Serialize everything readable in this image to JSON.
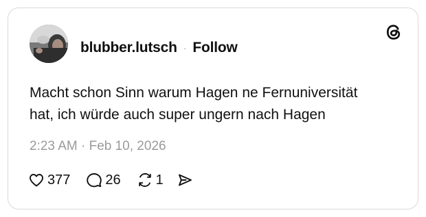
{
  "post": {
    "username": "blubber.lutsch",
    "separator": "·",
    "follow_label": "Follow",
    "text_lines": [
      "Macht schon Sinn warum Hagen ne Fernuniversität",
      "hat, ich würde auch super ungern nach Hagen"
    ],
    "timestamp": "2:23 AM · Feb 10, 2026",
    "likes": "377",
    "replies": "26",
    "reposts": "1"
  },
  "icons": {
    "brand": "threads-logo-icon",
    "like": "heart-icon",
    "reply": "comment-bubble-icon",
    "repost": "repost-icon",
    "share": "send-icon"
  },
  "colors": {
    "text": "#101010",
    "muted": "#9a9a9a",
    "border": "#d9d9d9"
  }
}
